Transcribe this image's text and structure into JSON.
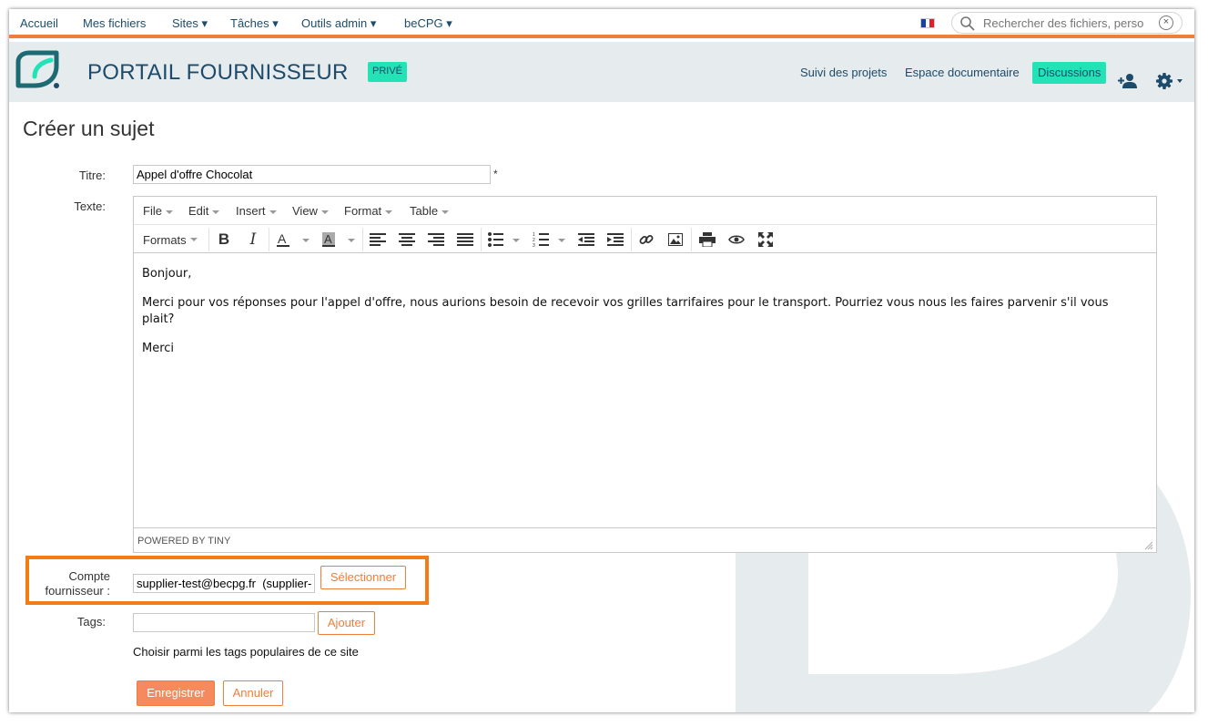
{
  "topnav": {
    "items": [
      {
        "label": "Accueil"
      },
      {
        "label": "Mes fichiers"
      },
      {
        "label": "Sites ▾"
      },
      {
        "label": "Tâches ▾"
      },
      {
        "label": "Outils admin ▾"
      },
      {
        "label": "beCPG ▾"
      }
    ],
    "search_placeholder": "Rechercher des fichiers, perso",
    "search_clear": "×",
    "flag_colors": [
      "#1b3fa0",
      "#ffffff",
      "#d8232a"
    ]
  },
  "header": {
    "site_title": "PORTAIL FOURNISSEUR",
    "visibility_badge": "PRIVÉ",
    "nav": [
      {
        "label": "Suivi des projets"
      },
      {
        "label": "Espace documentaire"
      },
      {
        "label": "Discussions"
      }
    ],
    "icons": [
      "add-user-icon",
      "gear-icon"
    ]
  },
  "page": {
    "heading": "Créer un sujet",
    "title_label": "Titre:",
    "title_value": "Appel d'offre Chocolat",
    "required_mark": "*",
    "text_label": "Texte:"
  },
  "editor": {
    "menu": [
      "File",
      "Edit",
      "Insert",
      "View",
      "Format",
      "Table"
    ],
    "formats_label": "Formats",
    "toolbar_icons": [
      "bold-icon",
      "italic-icon",
      "text-color-icon",
      "background-color-icon",
      "align-left-icon",
      "align-center-icon",
      "align-right-icon",
      "align-justify-icon",
      "bullet-list-icon",
      "numbered-list-icon",
      "outdent-icon",
      "indent-icon",
      "link-icon",
      "image-icon",
      "print-icon",
      "preview-icon",
      "fullscreen-icon"
    ],
    "paragraphs": [
      "Bonjour,",
      "Merci pour vos réponses pour l'appel d'offre, nous aurions besoin de recevoir vos grilles tarrifaires pour le transport. Pourriez vous nous les faires parvenir s'il vous plait?",
      "Merci"
    ],
    "statusbar": "POWERED BY TINY"
  },
  "supplier": {
    "label_line1": "Compte",
    "label_line2": "fournisseur :",
    "value": "supplier-test@becpg.fr  (supplier-test)",
    "select_button": "Sélectionner"
  },
  "tags": {
    "label": "Tags:",
    "value": "",
    "add_button": "Ajouter",
    "hint": "Choisir parmi les tags populaires de ce site"
  },
  "actions": {
    "save": "Enregistrer",
    "cancel": "Annuler"
  },
  "colors": {
    "accent_orange": "#f07d3a",
    "highlight_orange": "#f57c13",
    "brand_teal": "#1d4b6b",
    "brand_green": "#23e3b6",
    "header_bg": "#e6ebed"
  }
}
